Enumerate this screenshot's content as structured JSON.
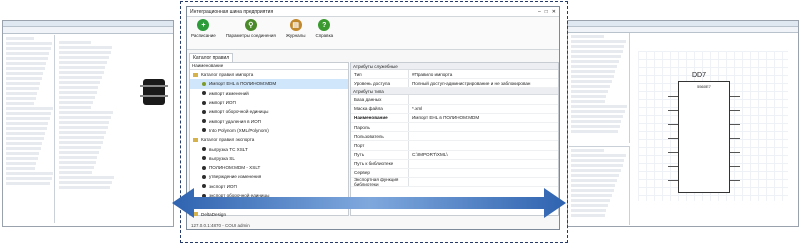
{
  "main": {
    "title": "Интеграционная шина предприятия",
    "toolbar": [
      {
        "label": "Расписание",
        "icon": "schedule-icon",
        "color": "#2e9b3a",
        "glyph": "+"
      },
      {
        "label": "Параметры соединения",
        "icon": "connection-icon",
        "color": "#4a8a2a",
        "glyph": "⚲"
      },
      {
        "label": "Журналы",
        "icon": "journal-icon",
        "color": "#c2882c",
        "glyph": "▤"
      },
      {
        "label": "Справка",
        "icon": "help-icon",
        "color": "#3b9a2f",
        "glyph": "?"
      }
    ],
    "tab": "Каталог правил",
    "tree_header": "Наименование",
    "tree": [
      {
        "label": "Каталог правил импорта",
        "type": "folder"
      },
      {
        "label": "Импорт EHL в ПОЛИНОМ:MDM",
        "type": "rule",
        "color": "#7d9a2a",
        "selected": true
      },
      {
        "label": "импорт изменений",
        "type": "rule",
        "color": "#2e2e2e"
      },
      {
        "label": "импорт ИОП",
        "type": "rule",
        "color": "#2e2e2e"
      },
      {
        "label": "импорт оборочной единицы",
        "type": "rule",
        "color": "#2e2e2e"
      },
      {
        "label": "импорт удаления в ИОП",
        "type": "rule",
        "color": "#2e2e2e"
      },
      {
        "label": "Into Polynom (XML/Polynom)",
        "type": "rule",
        "color": "#2e2e2e"
      },
      {
        "label": "Каталог правил экспорта",
        "type": "folder"
      },
      {
        "label": "выгрузка ТС XSLT",
        "type": "rule",
        "color": "#2e2e2e"
      },
      {
        "label": "выгрузка SL",
        "type": "rule",
        "color": "#2e2e2e"
      },
      {
        "label": "ПОЛИНОМ:MDM - XSLT",
        "type": "rule",
        "color": "#2e2e2e"
      },
      {
        "label": "утверждение изменения",
        "type": "rule",
        "color": "#2e2e2e"
      },
      {
        "label": "экспорт ИОП",
        "type": "rule",
        "color": "#2e2e2e"
      },
      {
        "label": "экспорт оборочной единицы",
        "type": "rule",
        "color": "#2e2e2e"
      },
      {
        "label": "экспорт удаления из ИОП",
        "type": "rule",
        "color": "#2e2e2e"
      },
      {
        "label": "DeltaDesign",
        "type": "folder"
      }
    ],
    "props_sections": [
      {
        "title": "Атрибуты служебные",
        "rows": [
          {
            "key": "Тип",
            "value": "#Правило импорта",
            "bold": false
          },
          {
            "key": "Уровень доступа",
            "value": "Полный доступ-администрирование и не заблокирован",
            "bold": false
          }
        ]
      },
      {
        "title": "Атрибуты типа",
        "rows": [
          {
            "key": "База данных",
            "value": "",
            "bold": false
          },
          {
            "key": "Маска файла",
            "value": "*.xml",
            "bold": false
          },
          {
            "key": "Наименование",
            "value": "Импорт EHL в ПОЛИНОМ:MDM",
            "bold": true
          },
          {
            "key": "Пароль",
            "value": "",
            "bold": false
          },
          {
            "key": "Пользователь",
            "value": "",
            "bold": false
          },
          {
            "key": "Порт",
            "value": "",
            "bold": false
          },
          {
            "key": "Путь",
            "value": "C:\\IMPORT\\XML\\",
            "bold": false
          },
          {
            "key": "Путь к библиотеке",
            "value": "",
            "bold": false
          },
          {
            "key": "Сервер",
            "value": "",
            "bold": false
          },
          {
            "key": "Экспортная функция библиотеки",
            "value": "",
            "bold": false
          }
        ]
      }
    ],
    "status": "127.0.0.1:4870 - COUI admin"
  },
  "right": {
    "ic_label": "DD7",
    "ic_part": "5560E7"
  },
  "colors": {
    "arrow_start": "#2f63b0",
    "arrow_end": "#7fa8dd",
    "frame": "#243b6b"
  }
}
